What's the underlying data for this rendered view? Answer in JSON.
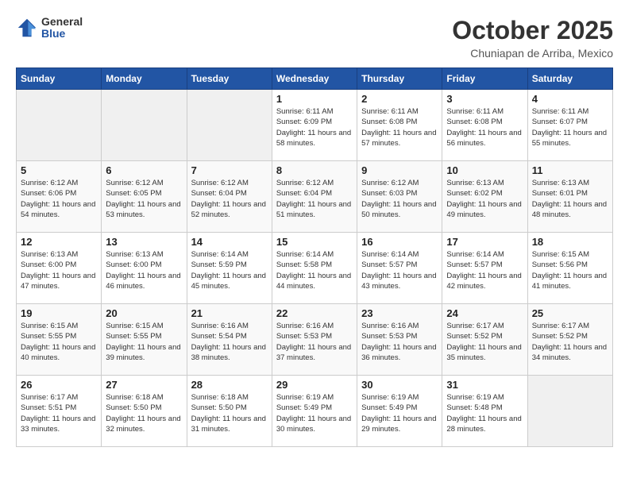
{
  "header": {
    "logo_general": "General",
    "logo_blue": "Blue",
    "title": "October 2025",
    "subtitle": "Chuniapan de Arriba, Mexico"
  },
  "days_of_week": [
    "Sunday",
    "Monday",
    "Tuesday",
    "Wednesday",
    "Thursday",
    "Friday",
    "Saturday"
  ],
  "weeks": [
    [
      {
        "day": "",
        "info": ""
      },
      {
        "day": "",
        "info": ""
      },
      {
        "day": "",
        "info": ""
      },
      {
        "day": "1",
        "info": "Sunrise: 6:11 AM\nSunset: 6:09 PM\nDaylight: 11 hours and 58 minutes."
      },
      {
        "day": "2",
        "info": "Sunrise: 6:11 AM\nSunset: 6:08 PM\nDaylight: 11 hours and 57 minutes."
      },
      {
        "day": "3",
        "info": "Sunrise: 6:11 AM\nSunset: 6:08 PM\nDaylight: 11 hours and 56 minutes."
      },
      {
        "day": "4",
        "info": "Sunrise: 6:11 AM\nSunset: 6:07 PM\nDaylight: 11 hours and 55 minutes."
      }
    ],
    [
      {
        "day": "5",
        "info": "Sunrise: 6:12 AM\nSunset: 6:06 PM\nDaylight: 11 hours and 54 minutes."
      },
      {
        "day": "6",
        "info": "Sunrise: 6:12 AM\nSunset: 6:05 PM\nDaylight: 11 hours and 53 minutes."
      },
      {
        "day": "7",
        "info": "Sunrise: 6:12 AM\nSunset: 6:04 PM\nDaylight: 11 hours and 52 minutes."
      },
      {
        "day": "8",
        "info": "Sunrise: 6:12 AM\nSunset: 6:04 PM\nDaylight: 11 hours and 51 minutes."
      },
      {
        "day": "9",
        "info": "Sunrise: 6:12 AM\nSunset: 6:03 PM\nDaylight: 11 hours and 50 minutes."
      },
      {
        "day": "10",
        "info": "Sunrise: 6:13 AM\nSunset: 6:02 PM\nDaylight: 11 hours and 49 minutes."
      },
      {
        "day": "11",
        "info": "Sunrise: 6:13 AM\nSunset: 6:01 PM\nDaylight: 11 hours and 48 minutes."
      }
    ],
    [
      {
        "day": "12",
        "info": "Sunrise: 6:13 AM\nSunset: 6:00 PM\nDaylight: 11 hours and 47 minutes."
      },
      {
        "day": "13",
        "info": "Sunrise: 6:13 AM\nSunset: 6:00 PM\nDaylight: 11 hours and 46 minutes."
      },
      {
        "day": "14",
        "info": "Sunrise: 6:14 AM\nSunset: 5:59 PM\nDaylight: 11 hours and 45 minutes."
      },
      {
        "day": "15",
        "info": "Sunrise: 6:14 AM\nSunset: 5:58 PM\nDaylight: 11 hours and 44 minutes."
      },
      {
        "day": "16",
        "info": "Sunrise: 6:14 AM\nSunset: 5:57 PM\nDaylight: 11 hours and 43 minutes."
      },
      {
        "day": "17",
        "info": "Sunrise: 6:14 AM\nSunset: 5:57 PM\nDaylight: 11 hours and 42 minutes."
      },
      {
        "day": "18",
        "info": "Sunrise: 6:15 AM\nSunset: 5:56 PM\nDaylight: 11 hours and 41 minutes."
      }
    ],
    [
      {
        "day": "19",
        "info": "Sunrise: 6:15 AM\nSunset: 5:55 PM\nDaylight: 11 hours and 40 minutes."
      },
      {
        "day": "20",
        "info": "Sunrise: 6:15 AM\nSunset: 5:55 PM\nDaylight: 11 hours and 39 minutes."
      },
      {
        "day": "21",
        "info": "Sunrise: 6:16 AM\nSunset: 5:54 PM\nDaylight: 11 hours and 38 minutes."
      },
      {
        "day": "22",
        "info": "Sunrise: 6:16 AM\nSunset: 5:53 PM\nDaylight: 11 hours and 37 minutes."
      },
      {
        "day": "23",
        "info": "Sunrise: 6:16 AM\nSunset: 5:53 PM\nDaylight: 11 hours and 36 minutes."
      },
      {
        "day": "24",
        "info": "Sunrise: 6:17 AM\nSunset: 5:52 PM\nDaylight: 11 hours and 35 minutes."
      },
      {
        "day": "25",
        "info": "Sunrise: 6:17 AM\nSunset: 5:52 PM\nDaylight: 11 hours and 34 minutes."
      }
    ],
    [
      {
        "day": "26",
        "info": "Sunrise: 6:17 AM\nSunset: 5:51 PM\nDaylight: 11 hours and 33 minutes."
      },
      {
        "day": "27",
        "info": "Sunrise: 6:18 AM\nSunset: 5:50 PM\nDaylight: 11 hours and 32 minutes."
      },
      {
        "day": "28",
        "info": "Sunrise: 6:18 AM\nSunset: 5:50 PM\nDaylight: 11 hours and 31 minutes."
      },
      {
        "day": "29",
        "info": "Sunrise: 6:19 AM\nSunset: 5:49 PM\nDaylight: 11 hours and 30 minutes."
      },
      {
        "day": "30",
        "info": "Sunrise: 6:19 AM\nSunset: 5:49 PM\nDaylight: 11 hours and 29 minutes."
      },
      {
        "day": "31",
        "info": "Sunrise: 6:19 AM\nSunset: 5:48 PM\nDaylight: 11 hours and 28 minutes."
      },
      {
        "day": "",
        "info": ""
      }
    ]
  ]
}
